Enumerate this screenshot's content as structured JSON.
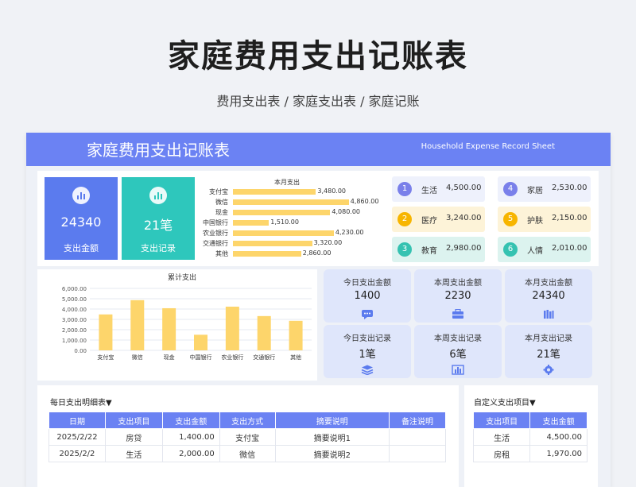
{
  "page": {
    "title": "家庭费用支出记账表",
    "subtitle": "费用支出表 / 家庭支出表 / 家庭记账"
  },
  "sheet": {
    "title": "家庭费用支出记账表",
    "title_en": "Household Expense Record Sheet"
  },
  "kpis": [
    {
      "value": "24340",
      "label": "支出金额",
      "color": "#5b7bee",
      "icon": "bar-chart-icon"
    },
    {
      "value": "21笔",
      "label": "支出记录",
      "color": "#2ec7bc",
      "icon": "bar-chart-icon"
    }
  ],
  "monthly_chart": {
    "title": "本月支出",
    "categories": [
      "支付宝",
      "微信",
      "现金",
      "中国银行",
      "农业银行",
      "交通银行",
      "其他"
    ],
    "values": [
      3480,
      4860,
      4080,
      1510,
      4230,
      3320,
      2860
    ],
    "labels": [
      "3,480.00",
      "4,860.00",
      "4,080.00",
      "1,510.00",
      "4,230.00",
      "3,320.00",
      "2,860.00"
    ],
    "bar_color": "#fdd56b"
  },
  "categories": [
    {
      "num": "1",
      "name": "生活",
      "amount": "4,500.00",
      "bg": "#eef1fc",
      "dot": "#7a80ea"
    },
    {
      "num": "2",
      "name": "医疗",
      "amount": "3,240.00",
      "bg": "#fdf3d8",
      "dot": "#f7b500"
    },
    {
      "num": "3",
      "name": "教育",
      "amount": "2,980.00",
      "bg": "#dcf3ef",
      "dot": "#35c2b1"
    },
    {
      "num": "4",
      "name": "家居",
      "amount": "2,530.00",
      "bg": "#eef1fc",
      "dot": "#7a80ea"
    },
    {
      "num": "5",
      "name": "护肤",
      "amount": "2,150.00",
      "bg": "#fdf3d8",
      "dot": "#f7b500"
    },
    {
      "num": "6",
      "name": "人情",
      "amount": "2,010.00",
      "bg": "#dcf3ef",
      "dot": "#35c2b1"
    }
  ],
  "chart_data": {
    "type": "bar",
    "title": "累计支出",
    "categories": [
      "支付宝",
      "微信",
      "现金",
      "中国银行",
      "农业银行",
      "交通银行",
      "其他"
    ],
    "values": [
      3480,
      4860,
      4080,
      1510,
      4230,
      3320,
      2860
    ],
    "yticks": [
      "0.00",
      "1,000.00",
      "2,000.00",
      "3,000.00",
      "4,000.00",
      "5,000.00",
      "6,000.00"
    ],
    "ylim": [
      0,
      6000
    ],
    "bar_color": "#fdd56b",
    "grid": true
  },
  "stats": [
    {
      "title": "今日支出金额",
      "value": "1400",
      "icon": "chat-icon"
    },
    {
      "title": "本周支出金额",
      "value": "2230",
      "icon": "briefcase-icon"
    },
    {
      "title": "本月支出金额",
      "value": "24340",
      "icon": "books-icon"
    },
    {
      "title": "今日支出记录",
      "value": "1笔",
      "icon": "stack-icon"
    },
    {
      "title": "本周支出记录",
      "value": "6笔",
      "icon": "chart-icon"
    },
    {
      "title": "本月支出记录",
      "value": "21笔",
      "icon": "gear-icon"
    }
  ],
  "daily_table": {
    "title": "每日支出明细表▼",
    "headers": [
      "日期",
      "支出项目",
      "支出金额",
      "支出方式",
      "摘要说明",
      "备注说明"
    ],
    "rows": [
      [
        "2025/2/22",
        "房贷",
        "1,400.00",
        "支付宝",
        "摘要说明1",
        ""
      ],
      [
        "2025/2/2",
        "生活",
        "2,000.00",
        "微信",
        "摘要说明2",
        ""
      ]
    ]
  },
  "custom_table": {
    "title": "自定义支出项目▼",
    "headers": [
      "支出项目",
      "支出金额"
    ],
    "rows": [
      [
        "生活",
        "4,500.00"
      ],
      [
        "房租",
        "1,970.00"
      ]
    ]
  }
}
